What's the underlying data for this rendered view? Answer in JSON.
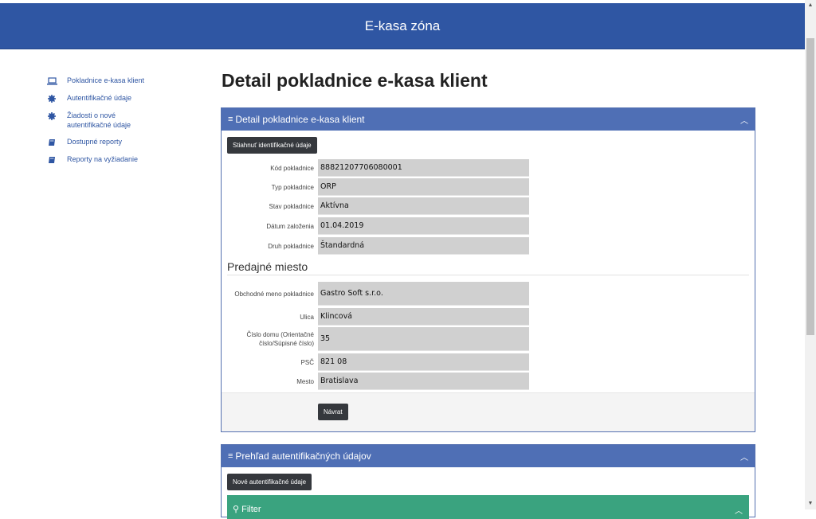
{
  "header": {
    "title": "E-kasa zóna"
  },
  "sidebar": {
    "items": [
      {
        "label": "Pokladnice e-kasa klient",
        "icon": "laptop-icon"
      },
      {
        "label": "Autentifikačné údaje",
        "icon": "gear-icon"
      },
      {
        "label": "Žiadosti o nové autentifikačné údaje",
        "icon": "gear-icon"
      },
      {
        "label": "Dostupné reporty",
        "icon": "book-icon"
      },
      {
        "label": "Reporty na vyžiadanie",
        "icon": "book-icon"
      }
    ]
  },
  "page": {
    "title": "Detail pokladnice e-kasa klient"
  },
  "detail_panel": {
    "title": "Detail pokladnice e-kasa klient",
    "download_button": "Stiahnuť identifikačné údaje",
    "fields": [
      {
        "label": "Kód pokladnice",
        "value": "88821207706080001"
      },
      {
        "label": "Typ pokladnice",
        "value": "ORP"
      },
      {
        "label": "Stav pokladnice",
        "value": "Aktívna"
      },
      {
        "label": "Dátum založenia",
        "value": "01.04.2019"
      },
      {
        "label": "Druh pokladnice",
        "value": "Štandardná"
      }
    ],
    "section_title": "Predajné miesto",
    "place_fields": [
      {
        "label": "Obchodné meno pokladnice",
        "value": "Gastro Soft s.r.o."
      },
      {
        "label": "Ulica",
        "value": "Klincová"
      },
      {
        "label": "Číslo domu (Orientačné číslo/Súpisné číslo)",
        "value": "35"
      },
      {
        "label": "PSČ",
        "value": "821 08"
      },
      {
        "label": "Mesto",
        "value": "Bratislava"
      }
    ],
    "back_button": "Návrat"
  },
  "auth_panel": {
    "title": "Prehľad autentifikačných údajov",
    "new_button": "Nové autentifikačné údaje",
    "filter_label": "Filter"
  },
  "colors": {
    "header": "#2f56a3",
    "panel_header": "#4f6fb5",
    "filter": "#3aa37f",
    "link": "#2f56a3"
  }
}
